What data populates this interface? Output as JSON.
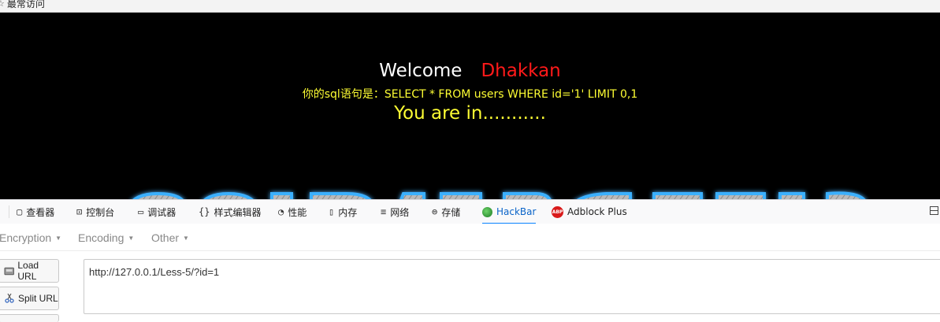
{
  "bookmarks": {
    "most_visited": "最常访问"
  },
  "page": {
    "welcome": "Welcome",
    "user_name": "Dhakkan",
    "sql_statement": "你的sql语句是：SELECT * FROM users WHERE id='1' LIMIT 0,1",
    "status": "You are in..........."
  },
  "devtools": {
    "tabs": [
      {
        "icon": "inspector-icon",
        "label": "查看器"
      },
      {
        "icon": "console-icon",
        "label": "控制台"
      },
      {
        "icon": "debugger-icon",
        "label": "调试器"
      },
      {
        "icon": "style-editor-icon",
        "label": "样式编辑器"
      },
      {
        "icon": "performance-icon",
        "label": "性能"
      },
      {
        "icon": "memory-icon",
        "label": "内存"
      },
      {
        "icon": "network-icon",
        "label": "网络"
      },
      {
        "icon": "storage-icon",
        "label": "存储"
      },
      {
        "icon": "hackbar-icon",
        "label": "HackBar",
        "active": true
      },
      {
        "icon": "adblock-icon",
        "label": "Adblock Plus"
      }
    ]
  },
  "hackbar": {
    "menus": [
      "Encryption",
      "Encoding",
      "Other"
    ],
    "buttons": {
      "load_url": "Load URL",
      "split_url": "Split URL"
    },
    "url_value": "http://127.0.0.1/Less-5/?id=1"
  },
  "colors": {
    "accent": "#0a84ff",
    "name_red": "#ff1a1a",
    "sql_yellow": "#ffff33",
    "banner_glow": "#3ab0ff"
  }
}
